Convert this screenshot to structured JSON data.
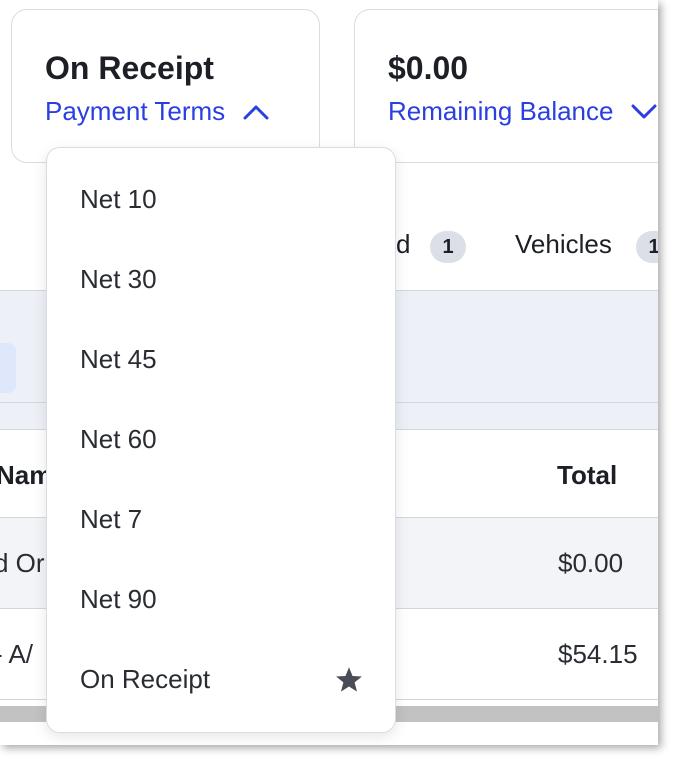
{
  "summary": {
    "terms_card": {
      "value": "On Receipt",
      "link_label": "Payment Terms"
    },
    "balance_card": {
      "value": "$0.00",
      "link_label": "Remaining Balance"
    }
  },
  "tabs": [
    {
      "label": "d",
      "count": "1"
    },
    {
      "label": "Vehicles",
      "count": "1"
    }
  ],
  "table": {
    "headers": {
      "name": "Nam",
      "total": "Total"
    },
    "rows": [
      {
        "name": "d Or",
        "total": "$0.00"
      },
      {
        "name": "- A/",
        "total": "$54.15"
      }
    ]
  },
  "payment_terms_menu": {
    "items": [
      {
        "label": "Net 10"
      },
      {
        "label": "Net 30"
      },
      {
        "label": "Net 45"
      },
      {
        "label": "Net 60"
      },
      {
        "label": "Net 7"
      },
      {
        "label": "Net 90"
      },
      {
        "label": "On Receipt",
        "icon": "star-icon"
      }
    ]
  },
  "colors": {
    "accent": "#2a3fe0",
    "text": "#1d1f27",
    "band": "#eef0f8",
    "badge": "#dcdfe7"
  }
}
